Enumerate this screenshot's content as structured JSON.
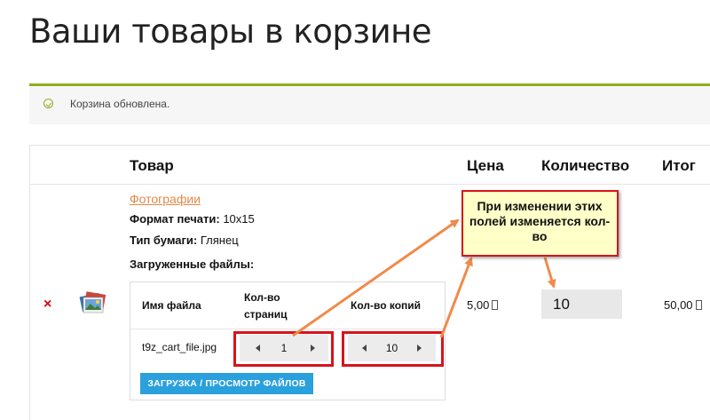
{
  "page": {
    "title": "Ваши товары в корзине"
  },
  "notice": {
    "icon": "check-circle-icon",
    "text": "Корзина обновлена."
  },
  "table": {
    "headers": {
      "product": "Товар",
      "price": "Цена",
      "quantity": "Количество",
      "total": "Итог"
    }
  },
  "item": {
    "remove_icon": "×",
    "thumbnail_icon": "photos-thumbnail-icon",
    "product_name": "Фотографии",
    "format_label": "Формат печати:",
    "format_value": "10x15",
    "paper_label": "Тип бумаги:",
    "paper_value": "Глянец",
    "files_label": "Загруженные файлы:",
    "files": {
      "col_name": "Имя файла",
      "col_pages": "Кол-во страниц",
      "col_copies": "Кол-во копий",
      "rows": [
        {
          "name": "t9z_cart_file.jpg",
          "pages": "1",
          "copies": "10"
        }
      ],
      "upload_button": "ЗАГРУЗКА / ПРОСМОТР ФАЙЛОВ"
    },
    "price": "5,00",
    "quantity": "10",
    "total": "50,00"
  },
  "annotation": {
    "text": "При изменении этих полей изменяется кол-во",
    "highlight_color": "#d7141a",
    "arrow_color": "#f08a4b"
  },
  "colors": {
    "notice_accent": "#8fae1b",
    "link": "#e08a4a",
    "button": "#2aa0dc",
    "remove": "#dd0000"
  }
}
